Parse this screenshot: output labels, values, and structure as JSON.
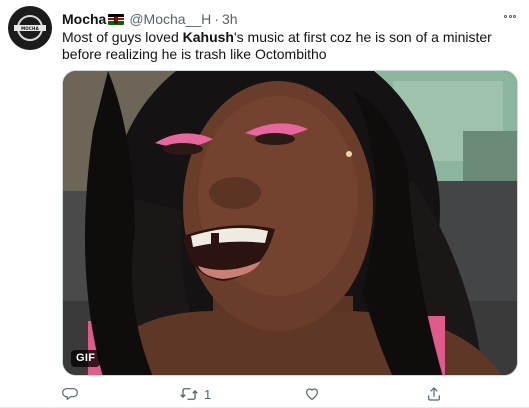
{
  "tweet": {
    "author_name": "Mocha",
    "handle": "@Mocha__H",
    "separator": "·",
    "time": "3h",
    "text_before": "Most of guys loved ",
    "text_bold": "Kahush",
    "text_after": "'s music at first coz he is son of a minister before realizing he is trash like Octombitho",
    "avatar_text": "MOCHA",
    "flag": "kenya-flag",
    "media": {
      "type": "gif",
      "badge": "GIF"
    },
    "actions": {
      "reply": {
        "icon": "reply-icon",
        "count": ""
      },
      "retweet": {
        "icon": "retweet-icon",
        "count": "1"
      },
      "like": {
        "icon": "heart-icon",
        "count": ""
      },
      "share": {
        "icon": "share-icon",
        "count": ""
      }
    },
    "more_icon": "more-icon"
  },
  "colors": {
    "text_primary": "#0f1419",
    "text_secondary": "#536471",
    "border": "#cfd9de"
  }
}
